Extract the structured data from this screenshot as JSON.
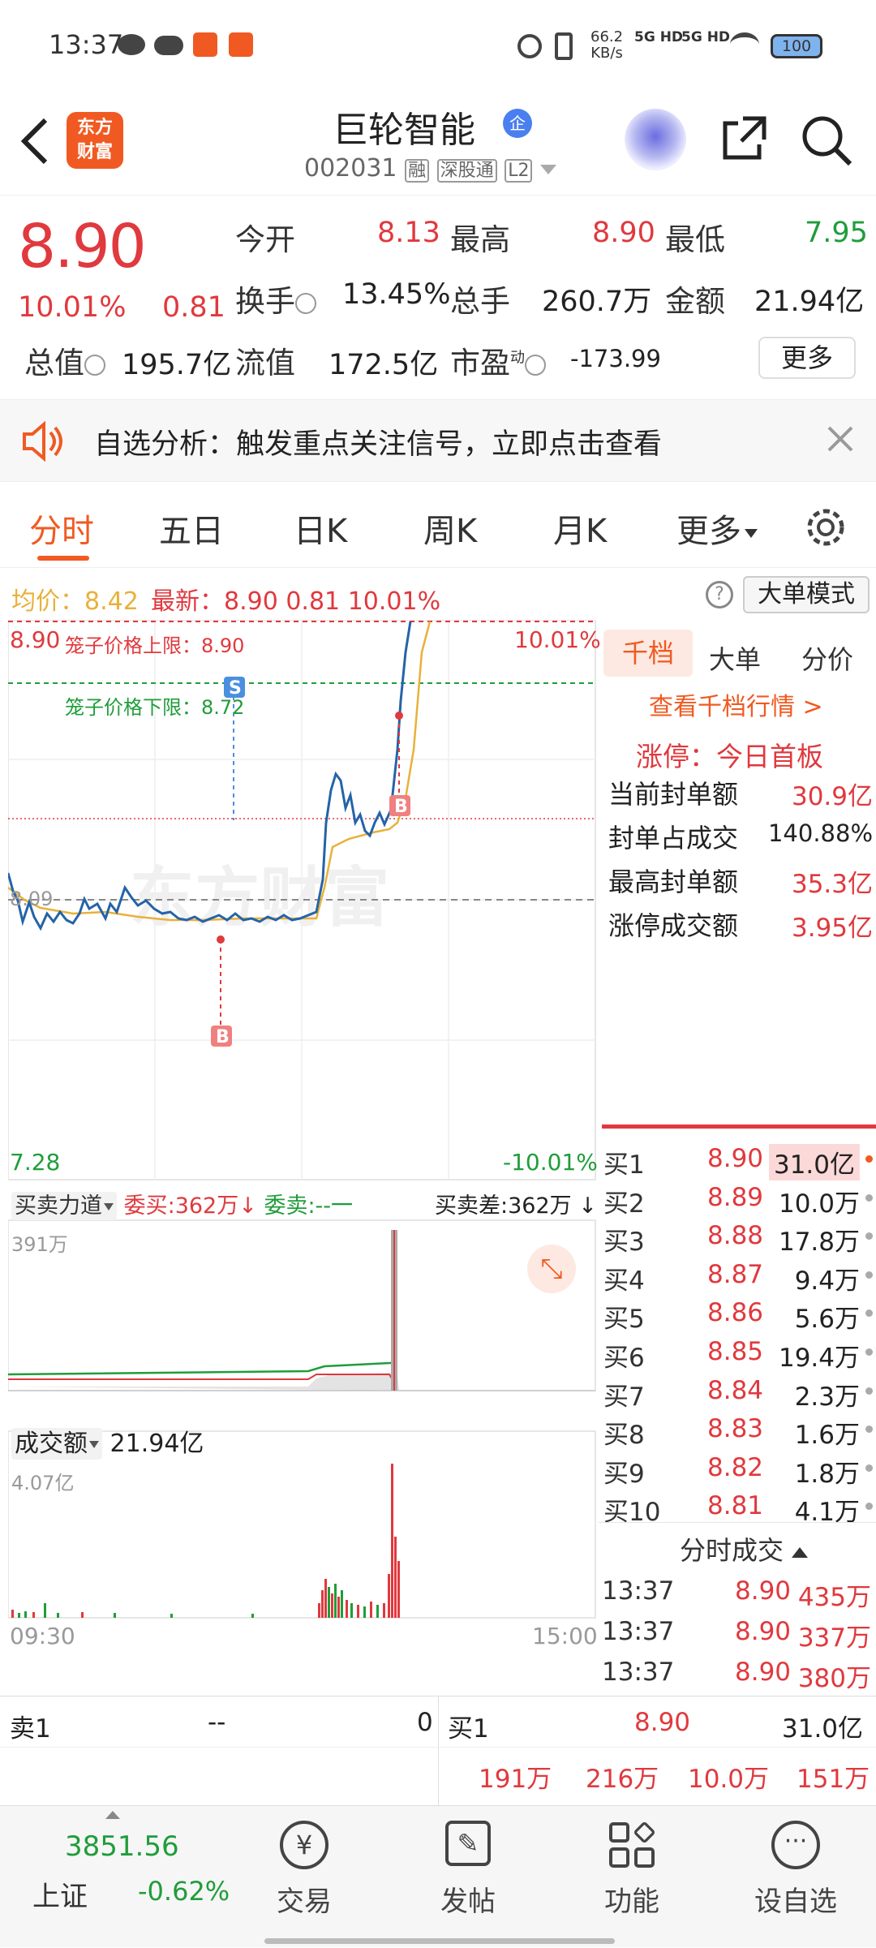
{
  "status": {
    "time": "13:37",
    "speed": "66.2",
    "speed_unit": "KB/s",
    "net1": "5G HD",
    "net2": "5G HD",
    "battery": "100"
  },
  "header": {
    "back_icon": "chevron-left",
    "logo_line1": "东方",
    "logo_line2": "财富",
    "stock_name": "巨轮智能",
    "stock_badge": "企",
    "code": "002031",
    "tag1": "融",
    "tag2": "深股通",
    "tag3": "L2"
  },
  "quote": {
    "price": "8.90",
    "change_pct": "10.01%",
    "change": "0.81",
    "open_label": "今开",
    "open": "8.13",
    "high_label": "最高",
    "high": "8.90",
    "low_label": "最低",
    "low": "7.95",
    "turnover_label": "换手",
    "turnover": "13.45%",
    "volume_label": "总手",
    "volume": "260.7万",
    "amount_label": "金额",
    "amount": "21.94亿",
    "mcap_label": "总值",
    "mcap": "195.7亿",
    "float_label": "流值",
    "float_cap": "172.5亿",
    "pe_label": "市盈",
    "pe_sup": "动",
    "pe": "-173.99",
    "more": "更多"
  },
  "alert": {
    "text": "自选分析：触发重点关注信号，立即点击查看"
  },
  "tabs": [
    "分时",
    "五日",
    "日K",
    "周K",
    "月K",
    "更多"
  ],
  "infobar": {
    "avg_label": "均价：",
    "avg": "8.42",
    "latest_label": "最新：",
    "latest": "8.90",
    "chg": "0.81",
    "pct": "10.01%",
    "mode": "大单模式"
  },
  "chart": {
    "top_price": "8.90",
    "limit_up_label": "笼子价格上限：8.90",
    "limit_down_label": "笼子价格下限：8.72",
    "top_pct": "10.01%",
    "bottom_price": "7.28",
    "bottom_pct": "-10.01%",
    "ref_price": "8.09",
    "marker_s": "S",
    "marker_b": "B",
    "watermark": "东方财富",
    "bs_label": "买卖力道",
    "bid_label": "委买:362万",
    "ask_label": "委卖:--一",
    "diff_label": "买卖差:362万",
    "vol_top": "391万",
    "amount_label": "成交额",
    "amount_val": "21.94亿",
    "amt_top": "4.07亿",
    "time_start": "09:30",
    "time_end": "15:00"
  },
  "panel": {
    "tabs": [
      "千档",
      "大单",
      "分价"
    ],
    "link": "查看千档行情 >",
    "limit_title": "涨停：今日首板",
    "rows": [
      {
        "k": "当前封单额",
        "v": "30.9亿"
      },
      {
        "k": "封单占成交",
        "v": "140.88%"
      },
      {
        "k": "最高封单额",
        "v": "35.3亿"
      },
      {
        "k": "涨停成交额",
        "v": "3.95亿"
      }
    ],
    "bids": [
      {
        "l": "买1",
        "p": "8.90",
        "v": "31.0亿"
      },
      {
        "l": "买2",
        "p": "8.89",
        "v": "10.0万"
      },
      {
        "l": "买3",
        "p": "8.88",
        "v": "17.8万"
      },
      {
        "l": "买4",
        "p": "8.87",
        "v": "9.4万"
      },
      {
        "l": "买5",
        "p": "8.86",
        "v": "5.6万"
      },
      {
        "l": "买6",
        "p": "8.85",
        "v": "19.4万"
      },
      {
        "l": "买7",
        "p": "8.84",
        "v": "2.3万"
      },
      {
        "l": "买8",
        "p": "8.83",
        "v": "1.6万"
      },
      {
        "l": "买9",
        "p": "8.82",
        "v": "1.8万"
      },
      {
        "l": "买10",
        "p": "8.81",
        "v": "4.1万"
      }
    ],
    "trades_title": "分时成交",
    "trades": [
      {
        "t": "13:37",
        "p": "8.90",
        "v": "435万"
      },
      {
        "t": "13:37",
        "p": "8.90",
        "v": "337万"
      },
      {
        "t": "13:37",
        "p": "8.90",
        "v": "380万"
      }
    ]
  },
  "bottom": {
    "sell1": "卖1",
    "sell1_price": "--",
    "sell1_vol": "0",
    "buy1": "买1",
    "buy1_price": "8.90",
    "buy1_vol": "31.0亿",
    "q1": "191万",
    "q2": "216万",
    "q3": "10.0万",
    "q4": "151万"
  },
  "nav": {
    "index_val": "3851.56",
    "index_name": "上证",
    "index_pct": "-0.62%",
    "trade": "交易",
    "post": "发帖",
    "func": "功能",
    "add": "设自选"
  },
  "colors": {
    "up": "#e0393e",
    "down": "#1f9d3a",
    "brand": "#f05a22",
    "avg_line": "#e8b13a",
    "price_line": "#2563a8"
  }
}
